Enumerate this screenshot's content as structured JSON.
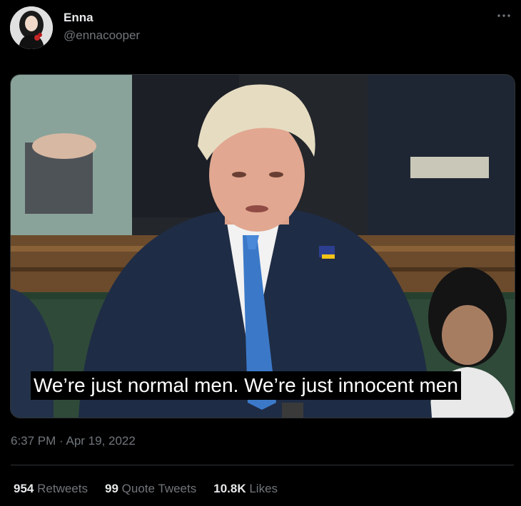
{
  "author": {
    "name": "Enna",
    "handle": "@ennacooper"
  },
  "media": {
    "subtitle": "We’re just normal men. We’re just innocent men"
  },
  "timestamp": {
    "time": "6:37 PM",
    "separator": " · ",
    "date": "Apr 19, 2022"
  },
  "stats": {
    "retweets_count": "954",
    "retweets_label": "Retweets",
    "quotes_count": "99",
    "quotes_label": "Quote Tweets",
    "likes_count": "10.8K",
    "likes_label": "Likes"
  },
  "icons": {
    "more": "more-horizontal-icon"
  },
  "colors": {
    "background": "#000000",
    "text_primary": "#e7e9ea",
    "text_secondary": "#71767b",
    "divider": "#2f3336"
  }
}
